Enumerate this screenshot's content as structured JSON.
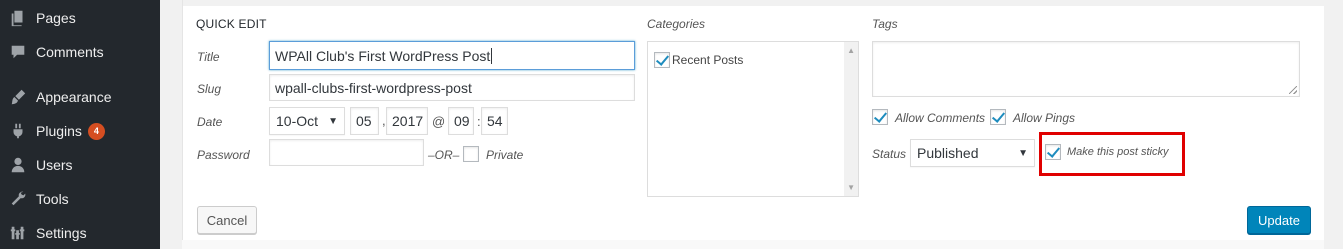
{
  "sidebar": {
    "items": [
      {
        "label": "Pages",
        "icon": "pages-icon"
      },
      {
        "label": "Comments",
        "icon": "comments-icon"
      },
      {
        "label": "Appearance",
        "icon": "appearance-icon"
      },
      {
        "label": "Plugins",
        "icon": "plugins-icon",
        "badge": "4"
      },
      {
        "label": "Users",
        "icon": "users-icon"
      },
      {
        "label": "Tools",
        "icon": "tools-icon"
      },
      {
        "label": "Settings",
        "icon": "settings-icon"
      }
    ]
  },
  "quick_edit": {
    "heading": "QUICK EDIT",
    "title_label": "Title",
    "title_value": "WPAll Club's First WordPress Post",
    "slug_label": "Slug",
    "slug_value": "wpall-clubs-first-wordpress-post",
    "date_label": "Date",
    "date_month": "10-Oct",
    "date_day": "05",
    "date_sep1": ",",
    "date_year": "2017",
    "date_at": "@",
    "date_hour": "09",
    "date_sep2": ":",
    "date_minute": "54",
    "password_label": "Password",
    "password_value": "",
    "or_label": "–OR–",
    "private_label": "Private",
    "private_checked": false
  },
  "categories": {
    "label": "Categories",
    "items": [
      {
        "label": "Recent Posts",
        "checked": true
      }
    ]
  },
  "tags": {
    "label": "Tags",
    "value": "",
    "allow_comments_label": "Allow Comments",
    "allow_comments_checked": true,
    "allow_pings_label": "Allow Pings",
    "allow_pings_checked": true,
    "status_label": "Status",
    "status_value": "Published",
    "sticky_label": "Make this post sticky",
    "sticky_checked": true
  },
  "buttons": {
    "cancel_label": "Cancel",
    "update_label": "Update"
  },
  "colors": {
    "accent": "#0085ba",
    "highlight": "#e00000",
    "sidebar_bg": "#23282d",
    "badge": "#d54e21"
  }
}
